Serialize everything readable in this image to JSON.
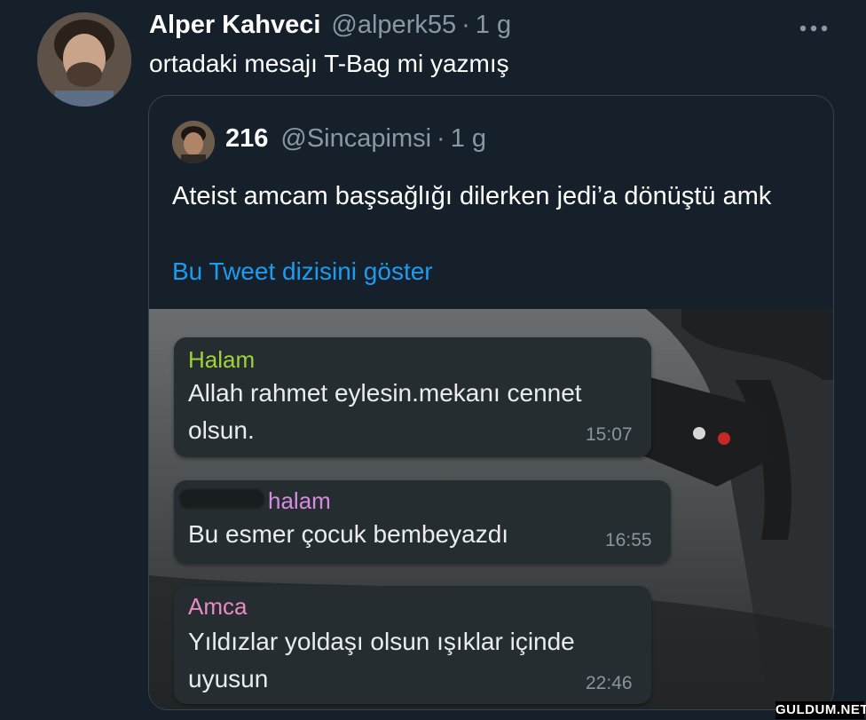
{
  "tweet": {
    "author_name": "Alper Kahveci",
    "handle": "@alperk55",
    "separator": "·",
    "time": "1 g",
    "text": "ortadaki mesajı T-Bag mi yazmış",
    "more_icon": "more-horizontal-icon"
  },
  "quoted_tweet": {
    "author_name": "216",
    "handle": "@Sincapimsi",
    "separator": "·",
    "time": "1 g",
    "text": "Ateist amcam başsağlığı dilerken jedi’a dönüştü amk",
    "thread_link": "Bu Tweet dizisini göster"
  },
  "chat_messages": [
    {
      "sender": "Halam",
      "text": "Allah rahmet eylesin.mekanı cennet olsun.",
      "time": "15:07",
      "sender_color": "#9fd33a"
    },
    {
      "sender": "halam",
      "text": "Bu esmer çocuk bembeyazdı",
      "time": "16:55",
      "sender_color": "#d68be0"
    },
    {
      "sender": "Amca",
      "text": "Yıldızlar yoldaşı olsun ışıklar içinde uyusun",
      "time": "22:46",
      "sender_color": "#e98bc4"
    }
  ],
  "watermark": "GULDUM.NET",
  "colors": {
    "background": "#15202b",
    "link": "#1d9bf0",
    "secondary_text": "#8899a6",
    "border": "#38444d"
  }
}
